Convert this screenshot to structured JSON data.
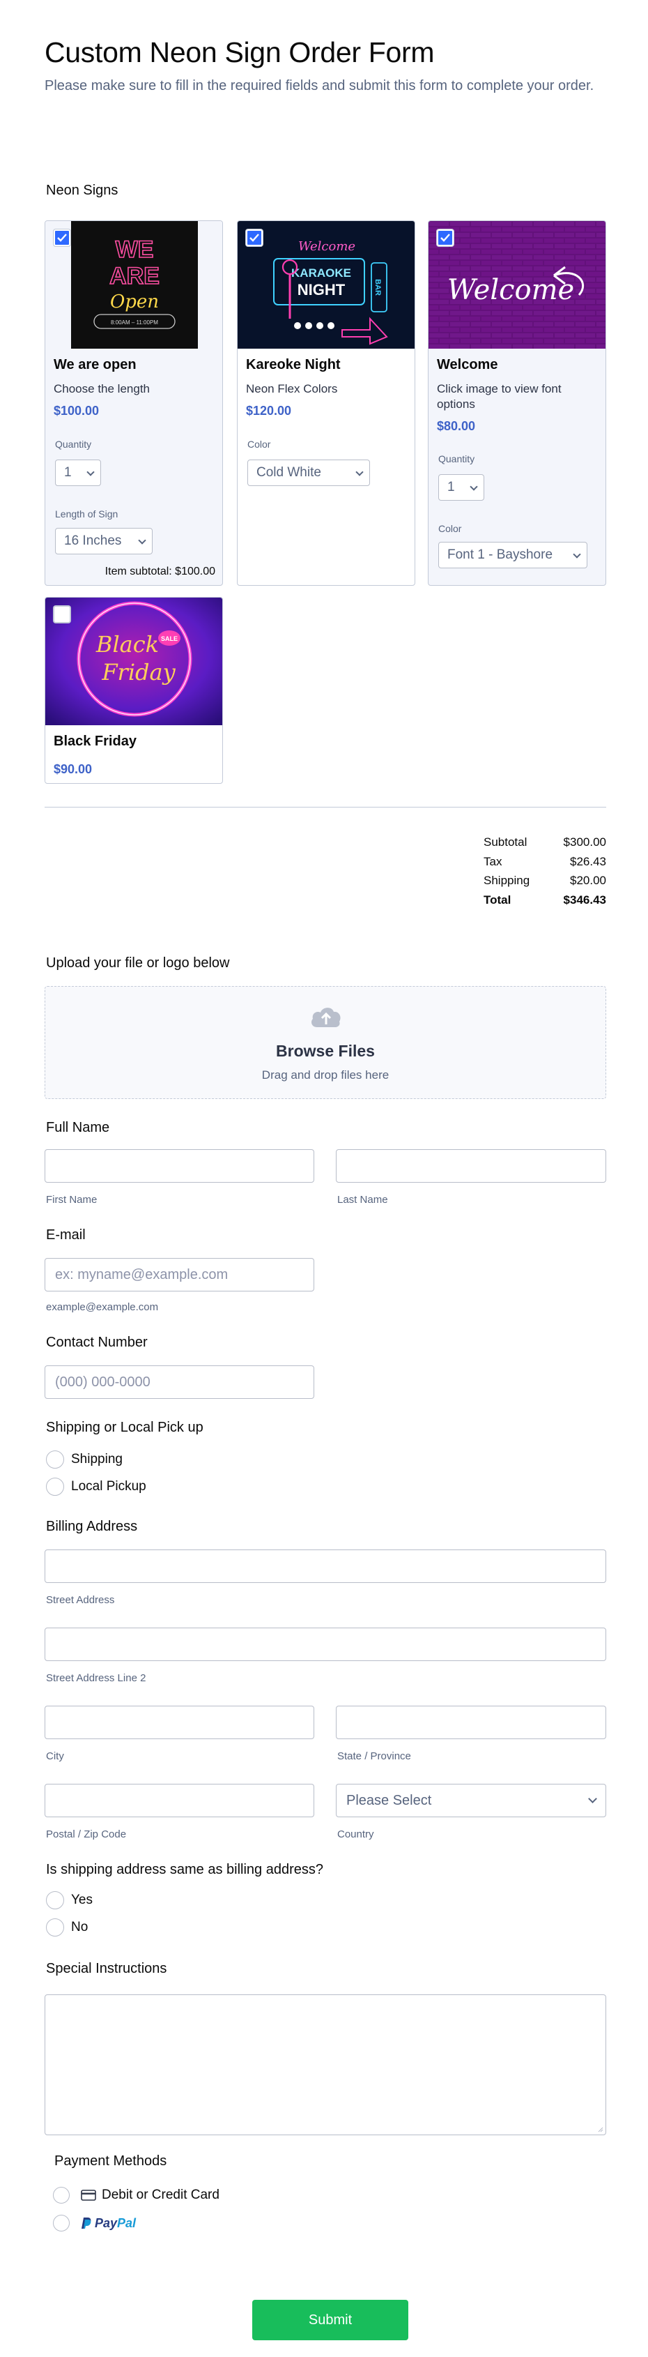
{
  "form": {
    "title": "Custom Neon Sign Order Form",
    "subtitle": "Please make sure to fill in the required fields and submit this form to complete your order."
  },
  "products": {
    "section_label": "Neon Signs",
    "items": [
      {
        "name": "We are open",
        "description": "Choose the length",
        "price": "$100.00",
        "selected": true,
        "image_text": [
          "WE",
          "ARE",
          "Open",
          "8:00AM – 11:00PM"
        ],
        "quantity_label": "Quantity",
        "quantity_value": "1",
        "option_label": "Length of Sign",
        "option_value": "16 Inches",
        "item_subtotal": "Item subtotal: $100.00"
      },
      {
        "name": "Kareoke Night",
        "description": "Neon Flex Colors",
        "price": "$120.00",
        "selected": true,
        "image_text": [
          "Welcome",
          "KARAOKE",
          "NIGHT",
          "BAR"
        ],
        "option_label": "Color",
        "option_value": "Cold White"
      },
      {
        "name": "Welcome",
        "description": "Click image to view font options",
        "price": "$80.00",
        "selected": true,
        "image_text": [
          "Welcome"
        ],
        "quantity_label": "Quantity",
        "quantity_value": "1",
        "option_label": "Color",
        "option_value": "Font 1 - Bayshore"
      },
      {
        "name": "Black Friday",
        "price": "$90.00",
        "selected": false,
        "image_text": [
          "Black",
          "Friday",
          "SALE"
        ]
      }
    ]
  },
  "totals": {
    "subtotal_label": "Subtotal",
    "subtotal_value": "$300.00",
    "tax_label": "Tax",
    "tax_value": "$26.43",
    "shipping_label": "Shipping",
    "shipping_value": "$20.00",
    "total_label": "Total",
    "total_value": "$346.43"
  },
  "upload": {
    "label": "Upload your file or logo below",
    "button": "Browse Files",
    "hint": "Drag and drop files here",
    "icon": "cloud-upload-icon"
  },
  "full_name": {
    "label": "Full Name",
    "first_hint": "First Name",
    "last_hint": "Last Name"
  },
  "email": {
    "label": "E-mail",
    "placeholder": "ex: myname@example.com",
    "hint": "example@example.com"
  },
  "contact": {
    "label": "Contact Number",
    "placeholder": "(000) 000-0000"
  },
  "shipping_option": {
    "label": "Shipping or Local Pick up",
    "options": [
      "Shipping",
      "Local Pickup"
    ]
  },
  "billing": {
    "label": "Billing Address",
    "street": "Street Address",
    "street2": "Street Address Line 2",
    "city": "City",
    "state": "State / Province",
    "postal": "Postal / Zip Code",
    "country": "Country",
    "country_placeholder": "Please Select"
  },
  "same_address": {
    "label": "Is shipping address same as billing address?",
    "options": [
      "Yes",
      "No"
    ]
  },
  "instructions": {
    "label": "Special Instructions"
  },
  "payment": {
    "label": "Payment Methods",
    "card": "Debit or Credit Card",
    "paypal": "PayPal"
  },
  "submit": {
    "label": "Submit"
  },
  "colors": {
    "accent": "#2e69ff",
    "price": "#3e62c8",
    "submit": "#18bd5b",
    "border": "#b8bdc9"
  }
}
